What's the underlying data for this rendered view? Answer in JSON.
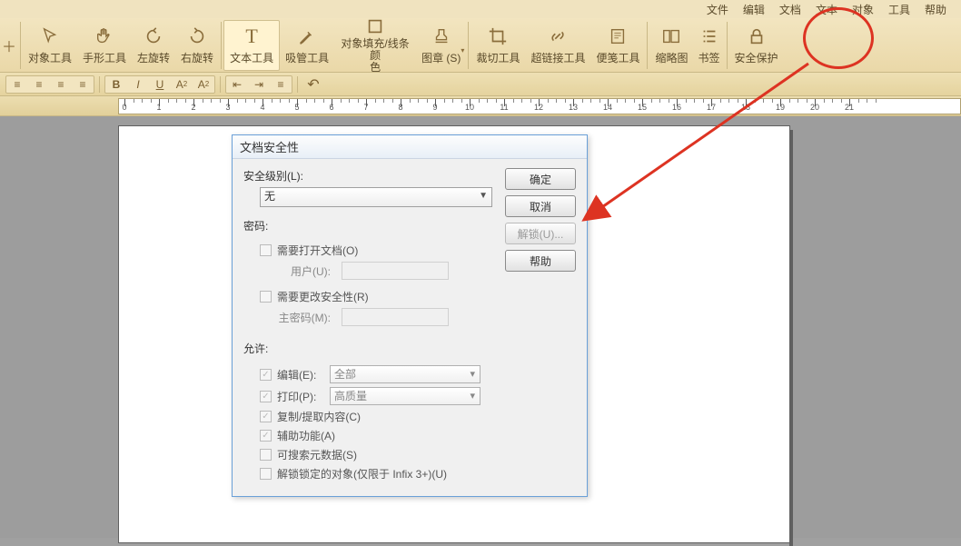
{
  "menu": [
    "文件",
    "编辑",
    "文档",
    "文本",
    "对象",
    "工具",
    "帮助"
  ],
  "toolbar": {
    "items": [
      {
        "id": "object-tool",
        "label": "对象工具"
      },
      {
        "id": "hand-tool",
        "label": "手形工具"
      },
      {
        "id": "rotate-left",
        "label": "左旋转"
      },
      {
        "id": "rotate-right",
        "label": "右旋转"
      },
      {
        "id": "text-tool",
        "label": "文本工具",
        "selected": true
      },
      {
        "id": "eyedropper-tool",
        "label": "吸管工具"
      },
      {
        "id": "fill-stroke",
        "label": "对象填充/线条颜色",
        "twoline": "对象填充/线条颜\n色"
      },
      {
        "id": "stamp",
        "label": "图章 (S)"
      },
      {
        "id": "crop-tool",
        "label": "裁切工具"
      },
      {
        "id": "hyperlink-tool",
        "label": "超链接工具"
      },
      {
        "id": "sticky-note-tool",
        "label": "便笺工具"
      },
      {
        "id": "thumbnails",
        "label": "缩略图"
      },
      {
        "id": "bookmarks",
        "label": "书签"
      },
      {
        "id": "security",
        "label": "安全保护"
      }
    ]
  },
  "dialog": {
    "title": "文档安全性",
    "security_level_label": "安全级别(L):",
    "security_level_value": "无",
    "buttons": {
      "ok": "确定",
      "cancel": "取消",
      "unlock": "解锁(U)...",
      "help": "帮助"
    },
    "password_section": "密码:",
    "need_open_doc": "需要打开文档(O)",
    "user_label": "用户(U):",
    "need_change_sec": "需要更改安全性(R)",
    "master_pw_label": "主密码(M):",
    "allow_section": "允许:",
    "edit_label": "编辑(E):",
    "edit_value": "全部",
    "print_label": "打印(P):",
    "print_value": "高质量",
    "copy_extract": "复制/提取内容(C)",
    "accessibility": "辅助功能(A)",
    "searchable_meta": "可搜索元数据(S)",
    "unlock_obj": "解锁锁定的对象(仅限于 Infix 3+)(U)"
  },
  "ruler": {
    "start": 0,
    "end": 21
  }
}
